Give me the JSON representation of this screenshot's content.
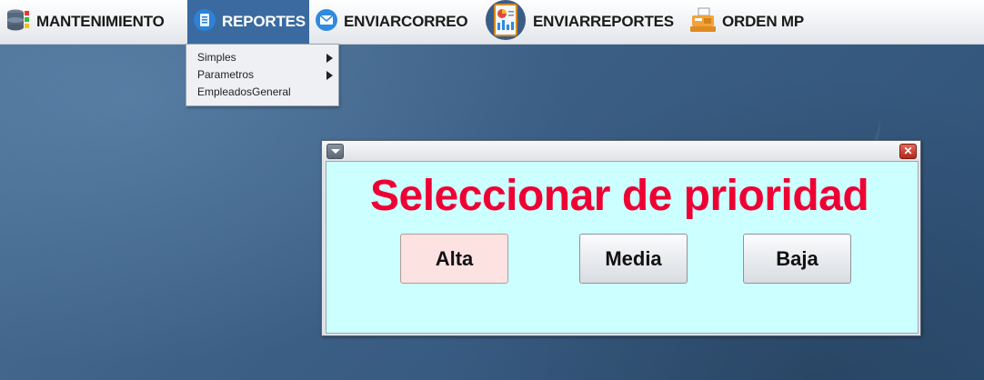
{
  "menubar": {
    "items": [
      {
        "label": "MANTENIMIENTO",
        "icon": "database-icon"
      },
      {
        "label": "REPORTES",
        "icon": "document-icon",
        "active": true
      },
      {
        "label": "ENVIARCORREO",
        "icon": "mail-icon"
      },
      {
        "label": "ENVIARREPORTES",
        "icon": "report-chart-icon"
      },
      {
        "label": "ORDEN MP",
        "icon": "cash-register-icon"
      }
    ]
  },
  "dropdown": {
    "items": [
      {
        "label": "Simples",
        "submenu": true
      },
      {
        "label": "Parametros",
        "submenu": true
      },
      {
        "label": "EmpleadosGeneral",
        "submenu": false
      }
    ]
  },
  "dialog": {
    "heading": "Seleccionar de prioridad",
    "close_glyph": "✕",
    "buttons": {
      "alta": "Alta",
      "media": "Media",
      "baja": "Baja"
    }
  },
  "colors": {
    "heading": "#ee0033",
    "content_bg": "#ccffff",
    "menu_active": "#3a6aa0",
    "alta_bg": "#fde2e2"
  }
}
